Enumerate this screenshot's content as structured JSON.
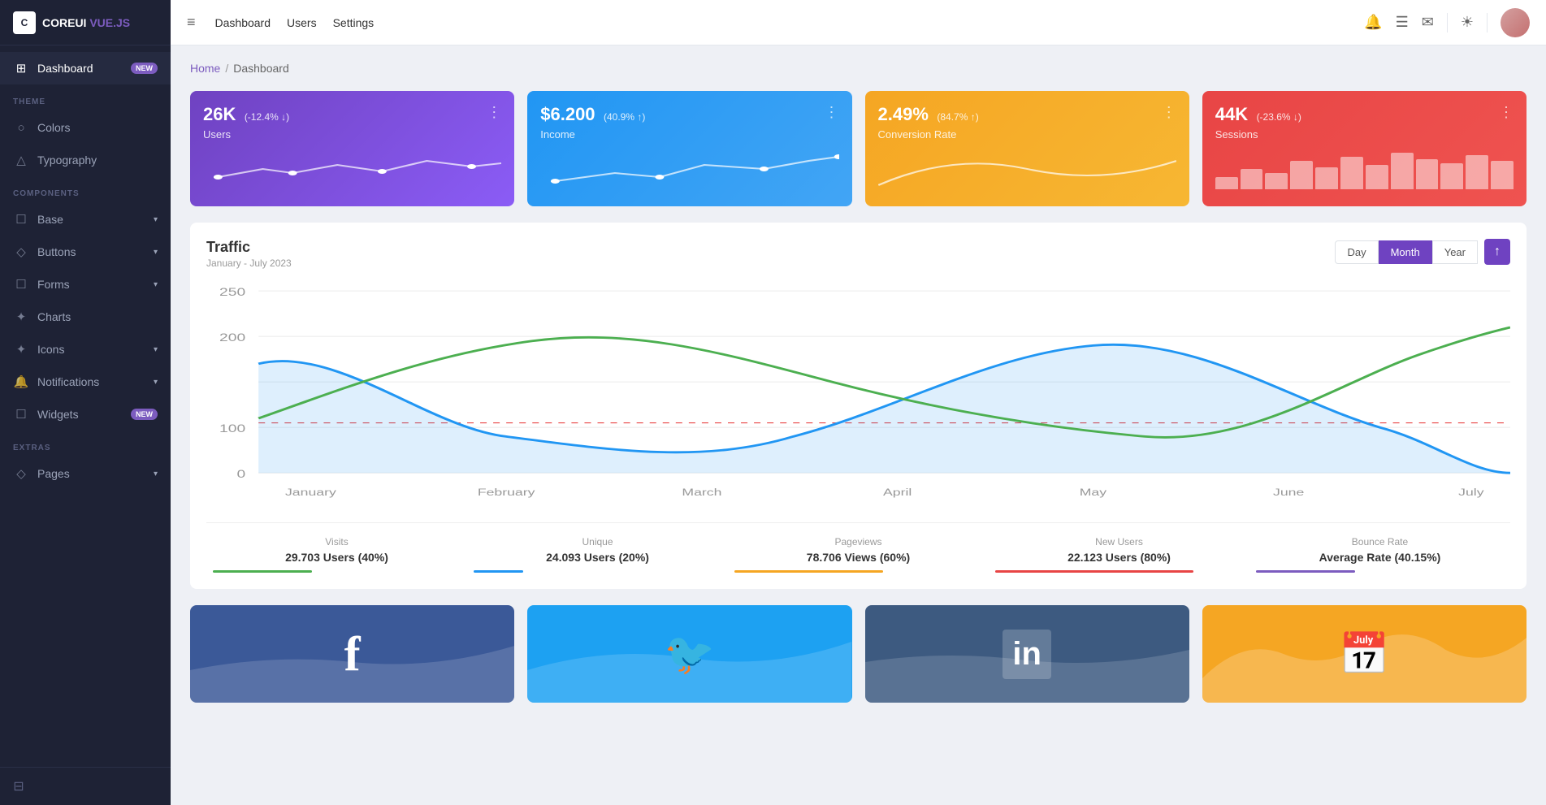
{
  "brand": {
    "logo_text": "COREUI",
    "logo_suffix": "VUE.JS"
  },
  "sidebar": {
    "theme_label": "THEME",
    "components_label": "COMPONENTS",
    "extras_label": "EXTRAS",
    "items": [
      {
        "id": "dashboard",
        "label": "Dashboard",
        "icon": "⊞",
        "badge": "NEW",
        "active": true
      },
      {
        "id": "colors",
        "label": "Colors",
        "icon": "○",
        "section": "theme"
      },
      {
        "id": "typography",
        "label": "Typography",
        "icon": "△",
        "section": "theme"
      },
      {
        "id": "base",
        "label": "Base",
        "icon": "☐",
        "section": "components",
        "has_chevron": true
      },
      {
        "id": "buttons",
        "label": "Buttons",
        "icon": "◇",
        "section": "components",
        "has_chevron": true
      },
      {
        "id": "forms",
        "label": "Forms",
        "icon": "☐",
        "section": "components",
        "has_chevron": true
      },
      {
        "id": "charts",
        "label": "Charts",
        "icon": "✦",
        "section": "components"
      },
      {
        "id": "icons",
        "label": "Icons",
        "icon": "✦",
        "section": "components",
        "has_chevron": true
      },
      {
        "id": "notifications",
        "label": "Notifications",
        "icon": "🔔",
        "section": "components",
        "has_chevron": true
      },
      {
        "id": "widgets",
        "label": "Widgets",
        "icon": "☐",
        "section": "components",
        "badge": "NEW"
      },
      {
        "id": "pages",
        "label": "Pages",
        "icon": "◇",
        "section": "extras",
        "has_chevron": true
      }
    ]
  },
  "topbar": {
    "nav_items": [
      "Dashboard",
      "Users",
      "Settings"
    ],
    "hamburger_label": "≡"
  },
  "breadcrumb": {
    "home": "Home",
    "current": "Dashboard"
  },
  "stat_cards": [
    {
      "id": "users",
      "value": "26K",
      "change": "(-12.4% ↓)",
      "label": "Users",
      "color": "purple"
    },
    {
      "id": "income",
      "value": "$6.200",
      "change": "(40.9% ↑)",
      "label": "Income",
      "color": "blue"
    },
    {
      "id": "conversion",
      "value": "2.49%",
      "change": "(84.7% ↑)",
      "label": "Conversion Rate",
      "color": "yellow"
    },
    {
      "id": "sessions",
      "value": "44K",
      "change": "(-23.6% ↓)",
      "label": "Sessions",
      "color": "red"
    }
  ],
  "traffic": {
    "title": "Traffic",
    "subtitle": "January - July 2023",
    "time_buttons": [
      "Day",
      "Month",
      "Year"
    ],
    "active_time": "Month",
    "y_labels": [
      "250",
      "200",
      "100",
      "0"
    ],
    "x_labels": [
      "January",
      "February",
      "March",
      "April",
      "May",
      "June",
      "July"
    ],
    "stats": [
      {
        "label": "Visits",
        "value": "29.703 Users (40%)",
        "color": "#4caf50"
      },
      {
        "label": "Unique",
        "value": "24.093 Users (20%)",
        "color": "#2196f3"
      },
      {
        "label": "Pageviews",
        "value": "78.706 Views (60%)",
        "color": "#f5a623"
      },
      {
        "label": "New Users",
        "value": "22.123 Users (80%)",
        "color": "#e84545"
      },
      {
        "label": "Bounce Rate",
        "value": "Average Rate (40.15%)",
        "color": "#7c5cbf"
      }
    ]
  },
  "social_cards": [
    {
      "id": "facebook",
      "icon": "f",
      "color": "#3b5998"
    },
    {
      "id": "twitter",
      "icon": "🐦",
      "color": "#1da1f2"
    },
    {
      "id": "linkedin",
      "icon": "in",
      "color": "#3d5a80"
    },
    {
      "id": "calendar",
      "icon": "📅",
      "color": "#f5a623"
    }
  ]
}
